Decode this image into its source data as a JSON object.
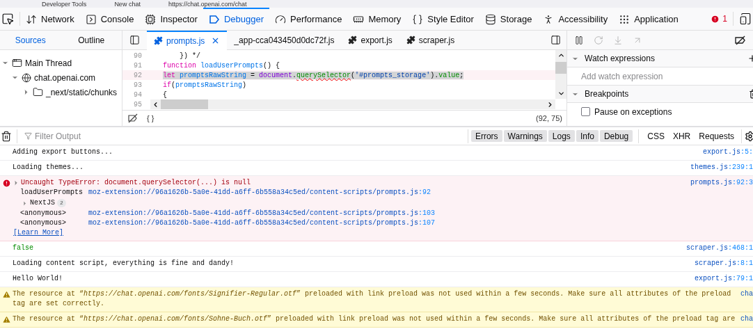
{
  "title_bar": [
    "Developer Tools",
    "New chat",
    "https://chat.openai.com/chat"
  ],
  "toolbar": {
    "tabs": [
      {
        "label": "Network",
        "selected": false
      },
      {
        "label": "Console",
        "selected": false
      },
      {
        "label": "Inspector",
        "selected": false
      },
      {
        "label": "Debugger",
        "selected": true
      },
      {
        "label": "Performance",
        "selected": false
      },
      {
        "label": "Memory",
        "selected": false
      },
      {
        "label": "Style Editor",
        "selected": false
      },
      {
        "label": "Storage",
        "selected": false
      },
      {
        "label": "Accessibility",
        "selected": false
      },
      {
        "label": "Application",
        "selected": false
      }
    ],
    "error_count": "1"
  },
  "sources_panel": {
    "tabs": [
      {
        "label": "Sources",
        "selected": true
      },
      {
        "label": "Outline",
        "selected": false
      }
    ],
    "tree": [
      {
        "label": "Main Thread",
        "kind": "thread",
        "expanded": true,
        "children": [
          {
            "label": "chat.openai.com",
            "kind": "domain",
            "expanded": true,
            "children": [
              {
                "label": "_next/static/chunks",
                "kind": "folder",
                "expanded": false
              }
            ]
          }
        ]
      }
    ]
  },
  "editor": {
    "tabs": [
      {
        "label": "prompts.js",
        "extension": true,
        "selected": true
      },
      {
        "label": "_app-cca043450d0dc72f.js",
        "extension": false,
        "selected": false
      },
      {
        "label": "export.js",
        "extension": true,
        "selected": false
      },
      {
        "label": "scraper.js",
        "extension": true,
        "selected": false
      }
    ],
    "lines": [
      {
        "number": "90",
        "highlighted": false,
        "tokens": [
          {
            "text": "    }) */",
            "kind": "plain"
          }
        ]
      },
      {
        "number": "91",
        "highlighted": false,
        "tokens": [
          {
            "text": "function ",
            "kind": "keyword"
          },
          {
            "text": "loadUserPrompts",
            "kind": "name"
          },
          {
            "text": "() {",
            "kind": "plain"
          }
        ]
      },
      {
        "number": "92",
        "highlighted": true,
        "tokens": [
          {
            "text": "let ",
            "kind": "keyword"
          },
          {
            "text": "promptsRawString",
            "kind": "name"
          },
          {
            "text": " = ",
            "kind": "plain"
          },
          {
            "text": "document",
            "kind": "object"
          },
          {
            "text": ".",
            "kind": "plain"
          },
          {
            "text": "querySelector",
            "kind": "method",
            "squiggle": true
          },
          {
            "text": "(",
            "kind": "plain"
          },
          {
            "text": "'#prompts_storage'",
            "kind": "string"
          },
          {
            "text": ").",
            "kind": "plain"
          },
          {
            "text": "value",
            "kind": "method"
          },
          {
            "text": ";",
            "kind": "plain"
          }
        ]
      },
      {
        "number": "93",
        "highlighted": false,
        "tokens": [
          {
            "text": "if",
            "kind": "keyword"
          },
          {
            "text": "(",
            "kind": "plain"
          },
          {
            "text": "promptsRawString",
            "kind": "name"
          },
          {
            "text": ")",
            "kind": "plain"
          }
        ]
      },
      {
        "number": "94",
        "highlighted": false,
        "tokens": [
          {
            "text": "{",
            "kind": "plain"
          }
        ]
      },
      {
        "number": "95",
        "highlighted": false
      }
    ],
    "pretty_print": "{ }",
    "cursor": "(92, 75)"
  },
  "debug_panel": {
    "watch_title": "Watch expressions",
    "watch_placeholder": "Add watch expression",
    "breakpoints_title": "Breakpoints",
    "pause_on_exceptions": {
      "label": "Pause on exceptions",
      "checked": false
    }
  },
  "console": {
    "filter_placeholder": "Filter Output",
    "filters": [
      {
        "label": "Errors",
        "selected": true
      },
      {
        "label": "Warnings",
        "selected": true
      },
      {
        "label": "Logs",
        "selected": true
      },
      {
        "label": "Info",
        "selected": true
      },
      {
        "label": "Debug",
        "selected": true
      }
    ],
    "toggles": [
      {
        "label": "CSS",
        "selected": false
      },
      {
        "label": "XHR",
        "selected": false
      },
      {
        "label": "Requests",
        "selected": false
      }
    ],
    "messages": [
      {
        "kind": "log",
        "text": "Adding export buttons...",
        "source": "export.js",
        "position": ":5:"
      },
      {
        "kind": "log",
        "text": "Loading themes...",
        "source": "themes.js",
        "position": ":239:1"
      },
      {
        "kind": "error",
        "text": "Uncaught TypeError: document.querySelector(...) is null",
        "source": "prompts.js",
        "position": ":92:3",
        "stack": [
          {
            "kind": "frame",
            "function": "loadUserPrompts",
            "url": "moz-extension://96a1626b-5a0e-41dd-a6ff-6b558a34c5ed/content-scripts/prompts.js",
            "line": ":92"
          },
          {
            "kind": "group",
            "function": "NextJS",
            "count": "2"
          },
          {
            "kind": "frame",
            "function": "<anonymous>",
            "url": "moz-extension://96a1626b-5a0e-41dd-a6ff-6b558a34c5ed/content-scripts/prompts.js",
            "line": ":103"
          },
          {
            "kind": "frame",
            "function": "<anonymous>",
            "url": "moz-extension://96a1626b-5a0e-41dd-a6ff-6b558a34c5ed/content-scripts/prompts.js",
            "line": ":107"
          }
        ],
        "learn_more": "[Learn More]"
      },
      {
        "kind": "value",
        "text": "false",
        "source": "scraper.js",
        "position": ":468:1"
      },
      {
        "kind": "log",
        "text": "Loading content script, everything is fine and dandy!",
        "source": "scraper.js",
        "position": ":8:1"
      },
      {
        "kind": "log",
        "text": "Hello World!",
        "source": "export.js",
        "position": ":79:1"
      },
      {
        "kind": "warning",
        "text": "The resource at “*https://chat.openai.com/fonts/Signifier-Regular.otf*” preloaded with link preload was not used within a few seconds. Make sure all attributes of the preload tag are set correctly.",
        "source": "cha"
      },
      {
        "kind": "warning",
        "text": "The resource at “*https://chat.openai.com/fonts/Sohne-Buch.otf*” preloaded with link preload was not used within a few seconds. Make sure all attributes of the preload tag are",
        "source": "cha"
      }
    ]
  }
}
